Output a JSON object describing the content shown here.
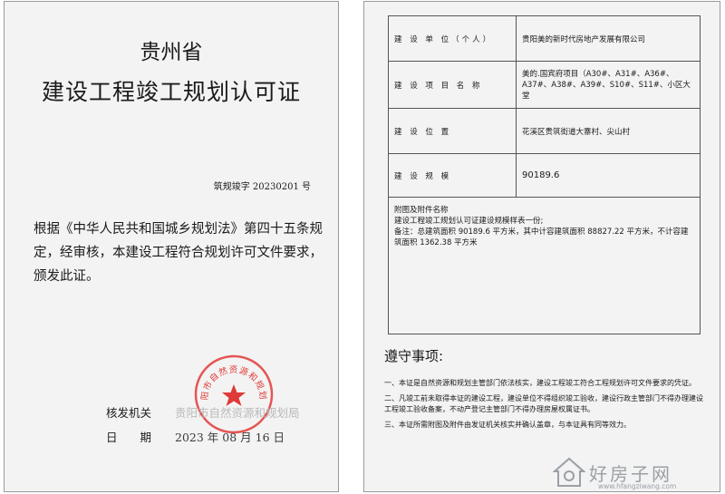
{
  "left": {
    "province": "贵州省",
    "title": "建设工程竣工规划认可证",
    "doc_no": "筑规竣字 20230201 号",
    "body_text": "根据《中华人民共和国城乡规划法》第四十五条规定，经审核，本建设工程符合规划许可文件要求，颁发此证。",
    "issuer_label": "核发机关",
    "issuer_value": "贵阳市自然资源和规划局",
    "date_label": "日　　期",
    "date_value": "2023 年 08 月 16 日",
    "seal_text": "贵阳市自然资源和规划局",
    "seal_color": "#e03a36"
  },
  "right": {
    "rows": [
      {
        "label": "建 设 单 位（个人）",
        "value": "贵阳美的新时代房地产发展有限公司"
      },
      {
        "label": "建 设 项 目 名 称",
        "value": "美的.国宾府项目（A30#、A31#、A36#、A37#、A38#、A39#、S10#、S11#、小区大堂"
      },
      {
        "label": "建 设 位 置",
        "value": "花溪区贵筑街道大寨村、尖山村"
      },
      {
        "label": "建 设 规 模",
        "value": "90189.6"
      }
    ],
    "attach_title": "附图及附件名称",
    "attach_line1": "建设工程竣工规划认可证建设规模样表一份;",
    "attach_line2": "备注：总建筑面积 90189.6 平方米，其中计容建筑面积 88827.22 平方米，不计容建筑面积 1362.38 平方米",
    "notes_title": "遵守事项:",
    "notes": [
      "一、本证是自然资源和规划主管部门依法核实，建设工程竣工符合工程规划许可文件要求的凭证。",
      "二、凡竣工前未取得本证的建设工程，建设单位不得组织竣工验收，建设行政主管部门不得办理建设工程竣工验收备案，不动产登记主管部门不得办理房屋权属证书。",
      "三、本证所需附图及附件由发证机关核实并确认盖章，与本证具有同等效力。"
    ]
  },
  "watermark": {
    "text": "好房子网",
    "url": "www.hfangziwang.com"
  }
}
